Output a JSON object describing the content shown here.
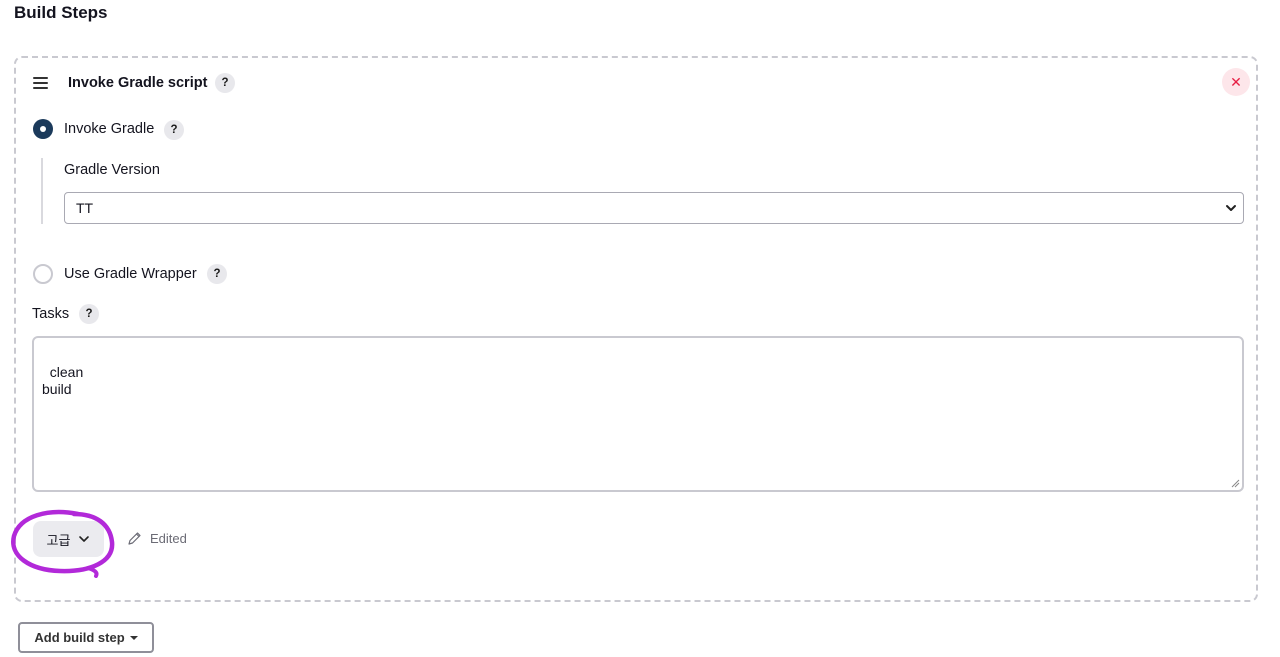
{
  "section_title": "Build Steps",
  "step": {
    "title": "Invoke Gradle script",
    "help_label": "?",
    "delete_label": "✕",
    "options": {
      "invoke_gradle": {
        "label": "Invoke Gradle",
        "selected": true
      },
      "use_wrapper": {
        "label": "Use Gradle Wrapper",
        "selected": false
      }
    },
    "gradle_version": {
      "label": "Gradle Version",
      "value": "TT"
    },
    "tasks": {
      "label": "Tasks",
      "value": "clean\nbuild"
    },
    "advanced_button": "고급",
    "edited_label": "Edited"
  },
  "add_build_step": "Add build step",
  "colors": {
    "accent": "#1b3a5b",
    "danger": "#e61e43",
    "annotation": "#b229d9"
  }
}
